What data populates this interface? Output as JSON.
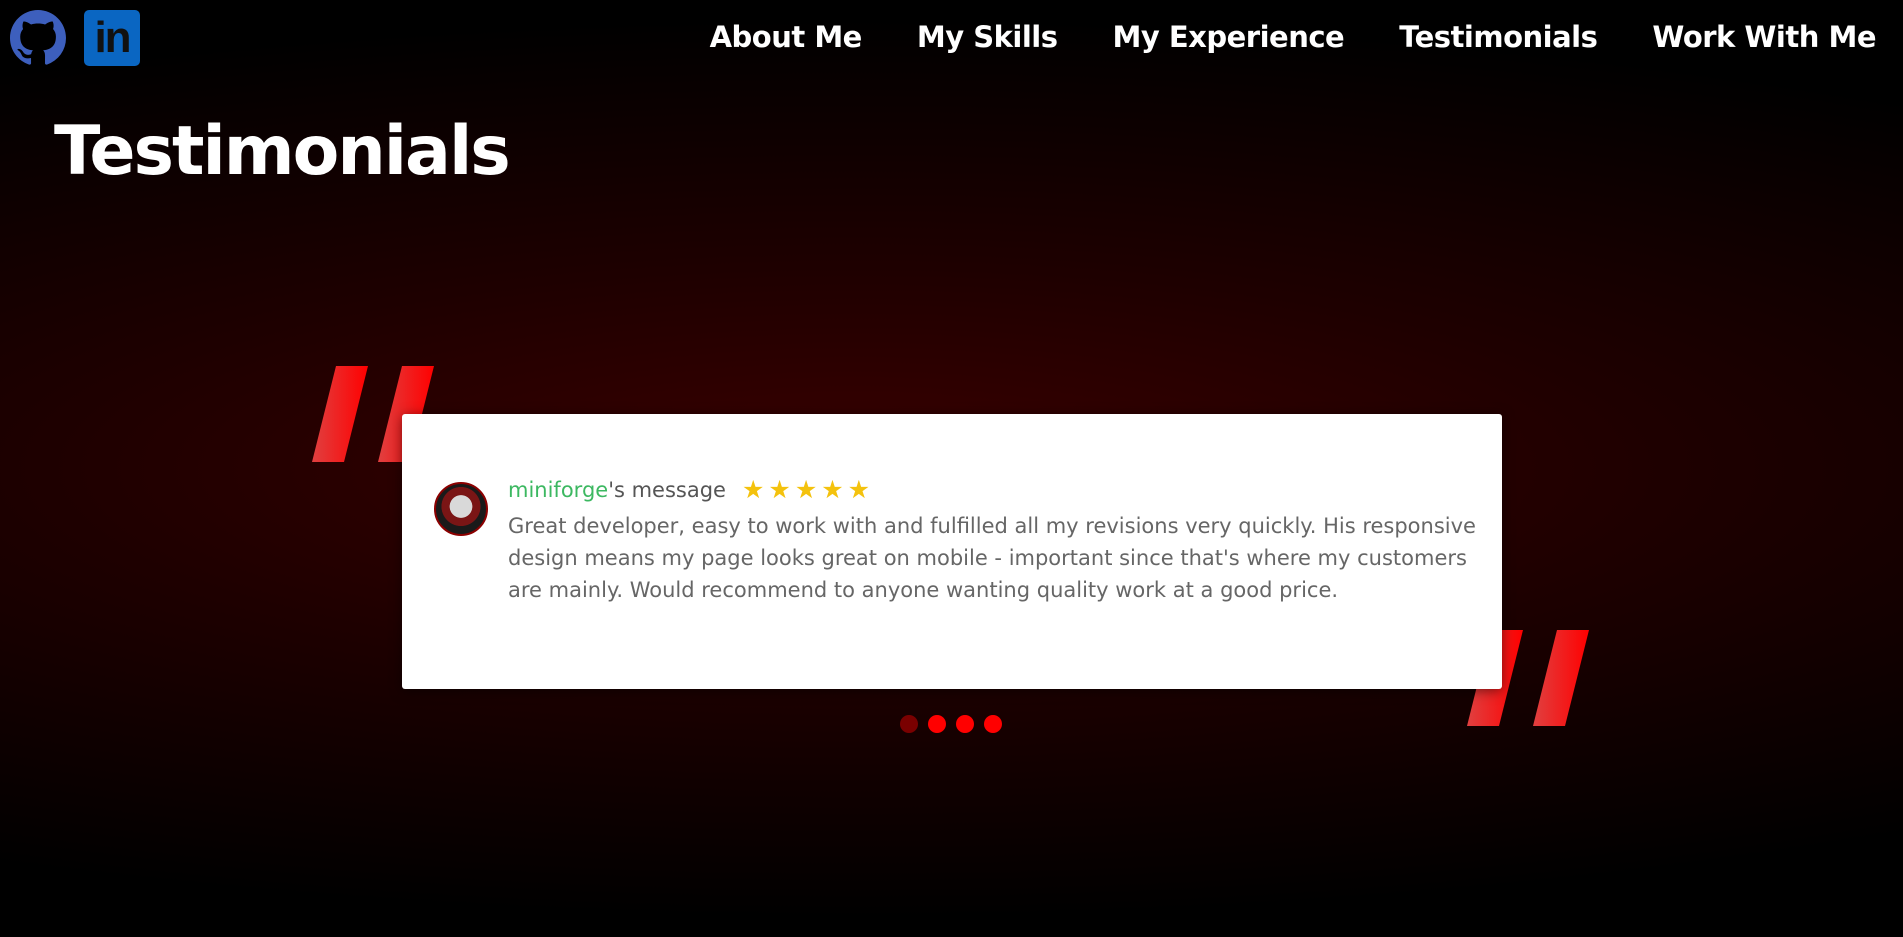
{
  "header": {
    "social": [
      {
        "name": "github-icon"
      },
      {
        "name": "linkedin-icon",
        "text": "in"
      }
    ],
    "nav": [
      {
        "label": "About Me"
      },
      {
        "label": "My Skills"
      },
      {
        "label": "My Experience"
      },
      {
        "label": "Testimonials"
      },
      {
        "label": "Work With Me"
      }
    ]
  },
  "page": {
    "title": "Testimonials"
  },
  "testimonial": {
    "username": "miniforge",
    "suffix": "'s message",
    "rating": 5,
    "text": "Great developer, easy to work with and fulfilled all my revisions very quickly. His responsive design means my page looks great on mobile - important since that's where my customers are mainly. Would recommend to anyone wanting quality work at a good price."
  },
  "carousel": {
    "count": 4,
    "active_index": 0
  },
  "colors": {
    "accent": "#ff1a1a",
    "username": "#3cb861",
    "star": "#f4c20d",
    "linkedin": "#0a66c2",
    "github": "#3d5fbd"
  }
}
